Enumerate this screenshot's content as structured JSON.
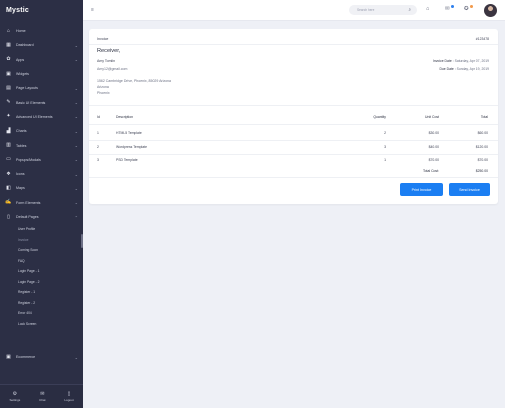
{
  "brand": {
    "name": "Mystic"
  },
  "sidebar": {
    "items": [
      {
        "label": "Home",
        "icon": "home-icon",
        "glyph": "⌂",
        "chevron": false
      },
      {
        "label": "Dashboard",
        "icon": "dashboard-icon",
        "glyph": "▦",
        "chevron": true
      },
      {
        "label": "Apps",
        "icon": "apps-icon",
        "glyph": "✿",
        "chevron": true
      },
      {
        "label": "Widgets",
        "icon": "widgets-icon",
        "glyph": "▣",
        "chevron": false
      },
      {
        "label": "Page Layouts",
        "icon": "layouts-icon",
        "glyph": "▤",
        "chevron": true
      },
      {
        "label": "Basic UI Elements",
        "icon": "ui-elements-icon",
        "glyph": "✎",
        "chevron": true
      },
      {
        "label": "Advanced UI Elements",
        "icon": "advanced-ui-icon",
        "glyph": "✦",
        "chevron": true
      },
      {
        "label": "Charts",
        "icon": "charts-icon",
        "glyph": "▟",
        "chevron": true
      },
      {
        "label": "Tables",
        "icon": "tables-icon",
        "glyph": "▥",
        "chevron": true
      },
      {
        "label": "Popups/Modals",
        "icon": "popups-icon",
        "glyph": "▭",
        "chevron": true
      },
      {
        "label": "Icons",
        "icon": "icons-icon",
        "glyph": "❖",
        "chevron": true
      },
      {
        "label": "Maps",
        "icon": "maps-icon",
        "glyph": "◧",
        "chevron": true
      },
      {
        "label": "Form Elements",
        "icon": "forms-icon",
        "glyph": "✍",
        "chevron": true
      },
      {
        "label": "Default Pages",
        "icon": "pages-icon",
        "glyph": "▯",
        "chevron": true,
        "open": true
      }
    ],
    "subitems": [
      "User Profile",
      "Invoice",
      "Coming Soon",
      "FAQ",
      "Login Page - 1",
      "Login Page - 2",
      "Register - 1",
      "Register - 2",
      "Error 404",
      "Lock Screen"
    ],
    "active_subitem": "Invoice",
    "ecommerce": {
      "label": "Ecommerce",
      "icon": "cart-icon",
      "glyph": "▣"
    },
    "footer": [
      {
        "label": "Settings",
        "icon": "settings-icon",
        "glyph": "⚙"
      },
      {
        "label": "Chat",
        "icon": "chat-icon",
        "glyph": "✉"
      },
      {
        "label": "Logout",
        "icon": "logout-icon",
        "glyph": "▯"
      }
    ]
  },
  "header": {
    "menu_glyph": "≡",
    "search_placeholder": "Search here",
    "icons": [
      {
        "name": "fullscreen-icon",
        "glyph": "⌂"
      },
      {
        "name": "notifications-icon",
        "glyph": "✉"
      },
      {
        "name": "messages-icon",
        "glyph": "✪"
      }
    ],
    "badge_colors": [
      "#2f80ed",
      "#f2994a"
    ]
  },
  "invoice": {
    "title": "Invoice",
    "number": "#123478",
    "receiver_heading": "Receiver,",
    "receiver_lines": [
      "Amy Tomlin",
      "Amy12@gmail.com",
      "1562 Cambridge Drive, Phoenix, 85029 Arizona",
      "Arizona",
      "Phoenix"
    ],
    "invoice_date_label": "Invoice Date :",
    "invoice_date": "Saturday, Apr 07, 2019",
    "due_date_label": "Due Date :",
    "due_date": "Sunday, Apr 19, 2019",
    "columns": [
      "Id",
      "Description",
      "Quantity",
      "Unit Cost",
      "Total"
    ],
    "rows": [
      {
        "id": "1",
        "description": "HTML5 Template",
        "quantity": "2",
        "unit_cost": "$30.00",
        "total": "$60.00"
      },
      {
        "id": "2",
        "description": "Wordpress Template",
        "quantity": "3",
        "unit_cost": "$40.00",
        "total": "$120.00"
      },
      {
        "id": "3",
        "description": "PSD Template",
        "quantity": "1",
        "unit_cost": "$70.00",
        "total": "$70.00"
      }
    ],
    "total_label": "Total Cost:",
    "total_value": "$250.00",
    "print_label": "Print Invoice",
    "send_label": "Send Invoice",
    "accent": "#1b7ef2"
  }
}
